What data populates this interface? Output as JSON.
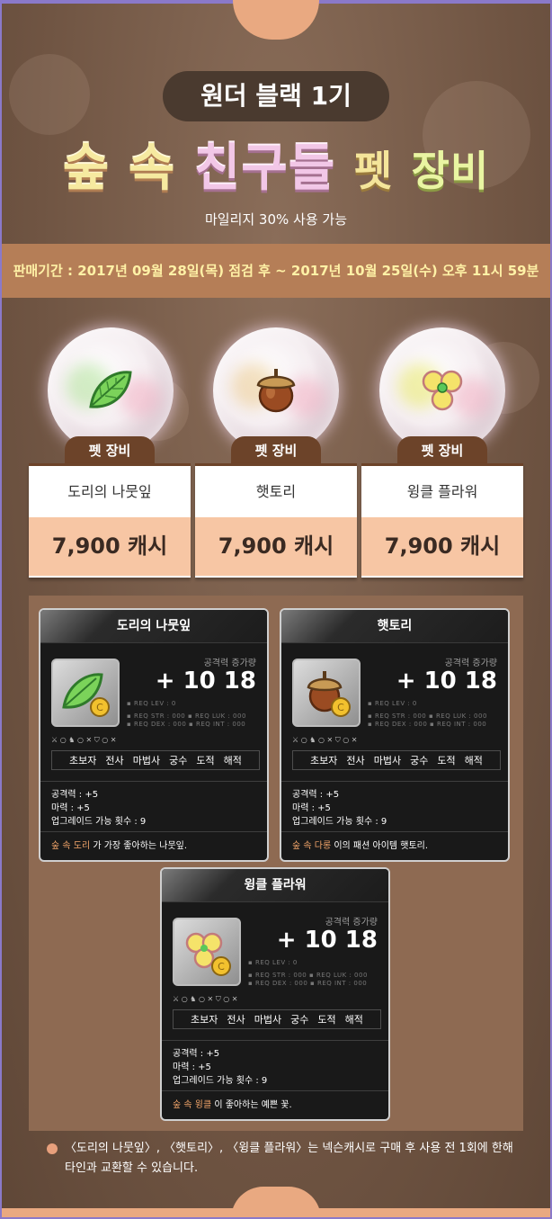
{
  "header": {
    "generation": "원더 블랙 1기",
    "title_parts": [
      "숲 속",
      "친구들",
      "펫",
      "장비"
    ],
    "subnote": "마일리지 30% 사용 가능"
  },
  "sale_period": "판매기간 : 2017년 09월 28일(목) 점검 후 ~ 2017년 10월 25일(수) 오후 11시 59분",
  "products": [
    {
      "tag": "펫 장비",
      "name": "도리의 나뭇잎",
      "price": "7,900 캐시",
      "icon": "leaf-icon"
    },
    {
      "tag": "펫 장비",
      "name": "햇토리",
      "price": "7,900 캐시",
      "icon": "acorn-icon"
    },
    {
      "tag": "펫 장비",
      "name": "윙클 플라워",
      "price": "7,900 캐시",
      "icon": "flower-icon"
    }
  ],
  "tooltips": [
    {
      "title": "도리의 나뭇잎",
      "power_label": "공격력 증가량",
      "power": "+ 10 18",
      "req_lev": "▪ REQ LEV :     0",
      "req_row1": "▪ REQ STR : 000  ▪ REQ LUK : 000",
      "req_row2": "▪ REQ DEX : 000  ▪ REQ INT : 000",
      "stat_icons": "⚔  ○ ♞  ○ ✕ ⛉  ○ ✕",
      "jobs": [
        "초보자",
        "전사",
        "마법사",
        "궁수",
        "도적",
        "해적"
      ],
      "stat1": "공격력 : +5",
      "stat2": "마력 : +5",
      "stat3": "업그레이드 가능 횟수 : 9",
      "desc_hl": "숲 속 도리",
      "desc_rest": " 가 가장 좋아하는 나뭇잎."
    },
    {
      "title": "햇토리",
      "power_label": "공격력 증가량",
      "power": "+ 10 18",
      "req_lev": "▪ REQ LEV :     0",
      "req_row1": "▪ REQ STR : 000  ▪ REQ LUK : 000",
      "req_row2": "▪ REQ DEX : 000  ▪ REQ INT : 000",
      "stat_icons": "⚔  ○ ♞  ○ ✕ ⛉  ○ ✕",
      "jobs": [
        "초보자",
        "전사",
        "마법사",
        "궁수",
        "도적",
        "해적"
      ],
      "stat1": "공격력 : +5",
      "stat2": "마력 : +5",
      "stat3": "업그레이드 가능 횟수 : 9",
      "desc_hl": "숲 속 다롱",
      "desc_rest": " 이의 패션 아이템 햇토리."
    },
    {
      "title": "윙클 플라워",
      "power_label": "공격력 증가량",
      "power": "+ 10 18",
      "req_lev": "▪ REQ LEV :     0",
      "req_row1": "▪ REQ STR : 000  ▪ REQ LUK : 000",
      "req_row2": "▪ REQ DEX : 000  ▪ REQ INT : 000",
      "stat_icons": "⚔  ○ ♞  ○ ✕ ⛉  ○ ✕",
      "jobs": [
        "초보자",
        "전사",
        "마법사",
        "궁수",
        "도적",
        "해적"
      ],
      "stat1": "공격력 : +5",
      "stat2": "마력 : +5",
      "stat3": "업그레이드 가능 횟수 : 9",
      "desc_hl": "숲 속 윙클",
      "desc_rest": " 이 좋아하는 예쁜 꽃."
    }
  ],
  "footnote": {
    "line1": "〈도리의 나뭇잎〉, 〈햇토리〉, 〈윙클 플라워〉는 넥슨캐시로 구매 후 사용 전 1회에 한해",
    "line2": "타인과 교환할 수 있습니다."
  }
}
